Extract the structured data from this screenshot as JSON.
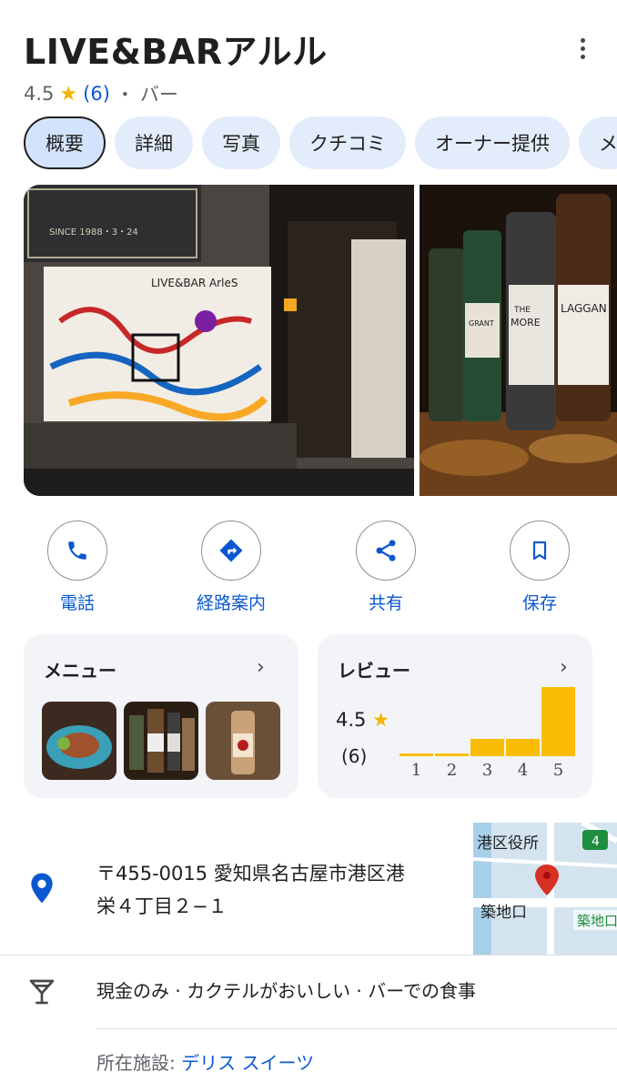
{
  "place": {
    "name": "LIVE&BARアルル",
    "rating": "4.5",
    "rating_star": "★",
    "review_count": "(6)",
    "separator": "・",
    "category": "バー"
  },
  "tabs": [
    {
      "label": "概要",
      "active": true
    },
    {
      "label": "詳細"
    },
    {
      "label": "写真"
    },
    {
      "label": "クチコミ"
    },
    {
      "label": "オーナー提供"
    },
    {
      "label": "メ"
    }
  ],
  "photos": {
    "photo1_sign_text": "SINCE 1988・3・24",
    "photo1_mural_text": "LIVE&BAR ArleS",
    "photo2_labels": [
      "THE",
      "MORE",
      "LAGGAN",
      "GRANT"
    ]
  },
  "actions": [
    {
      "label": "電話",
      "icon": "phone-icon"
    },
    {
      "label": "経路案内",
      "icon": "directions-icon"
    },
    {
      "label": "共有",
      "icon": "share-icon"
    },
    {
      "label": "保存",
      "icon": "bookmark-icon"
    }
  ],
  "menu_card": {
    "title": "メニュー",
    "chevron": "›"
  },
  "review_card": {
    "title": "レビュー",
    "chevron": "›",
    "score": "4.5",
    "star": "★",
    "count": "(6)"
  },
  "chart_data": {
    "type": "bar",
    "categories": [
      "1",
      "2",
      "3",
      "4",
      "5"
    ],
    "values": [
      0,
      0,
      1,
      1,
      4
    ],
    "ylim": [
      0,
      4
    ],
    "color": "#fbbc04"
  },
  "address": {
    "line1": "〒455-0015 愛知県名古屋市港区港",
    "line2": "栄４丁目２−１",
    "icon": "location-pin-icon"
  },
  "map": {
    "label1": "港区役所",
    "label2": "築地口",
    "label3": "築地口",
    "route_number": "4"
  },
  "features": {
    "icon": "cocktail-icon",
    "text": "現金のみ · カクテルがおいしい · バーでの食事"
  },
  "facility": {
    "prefix": "所在施設: ",
    "name": "デリス スイーツ"
  },
  "colors": {
    "accent": "#0b57d0",
    "star": "#f4b400",
    "bar": "#fbbc04",
    "tab_bg": "#e3ecfb"
  }
}
